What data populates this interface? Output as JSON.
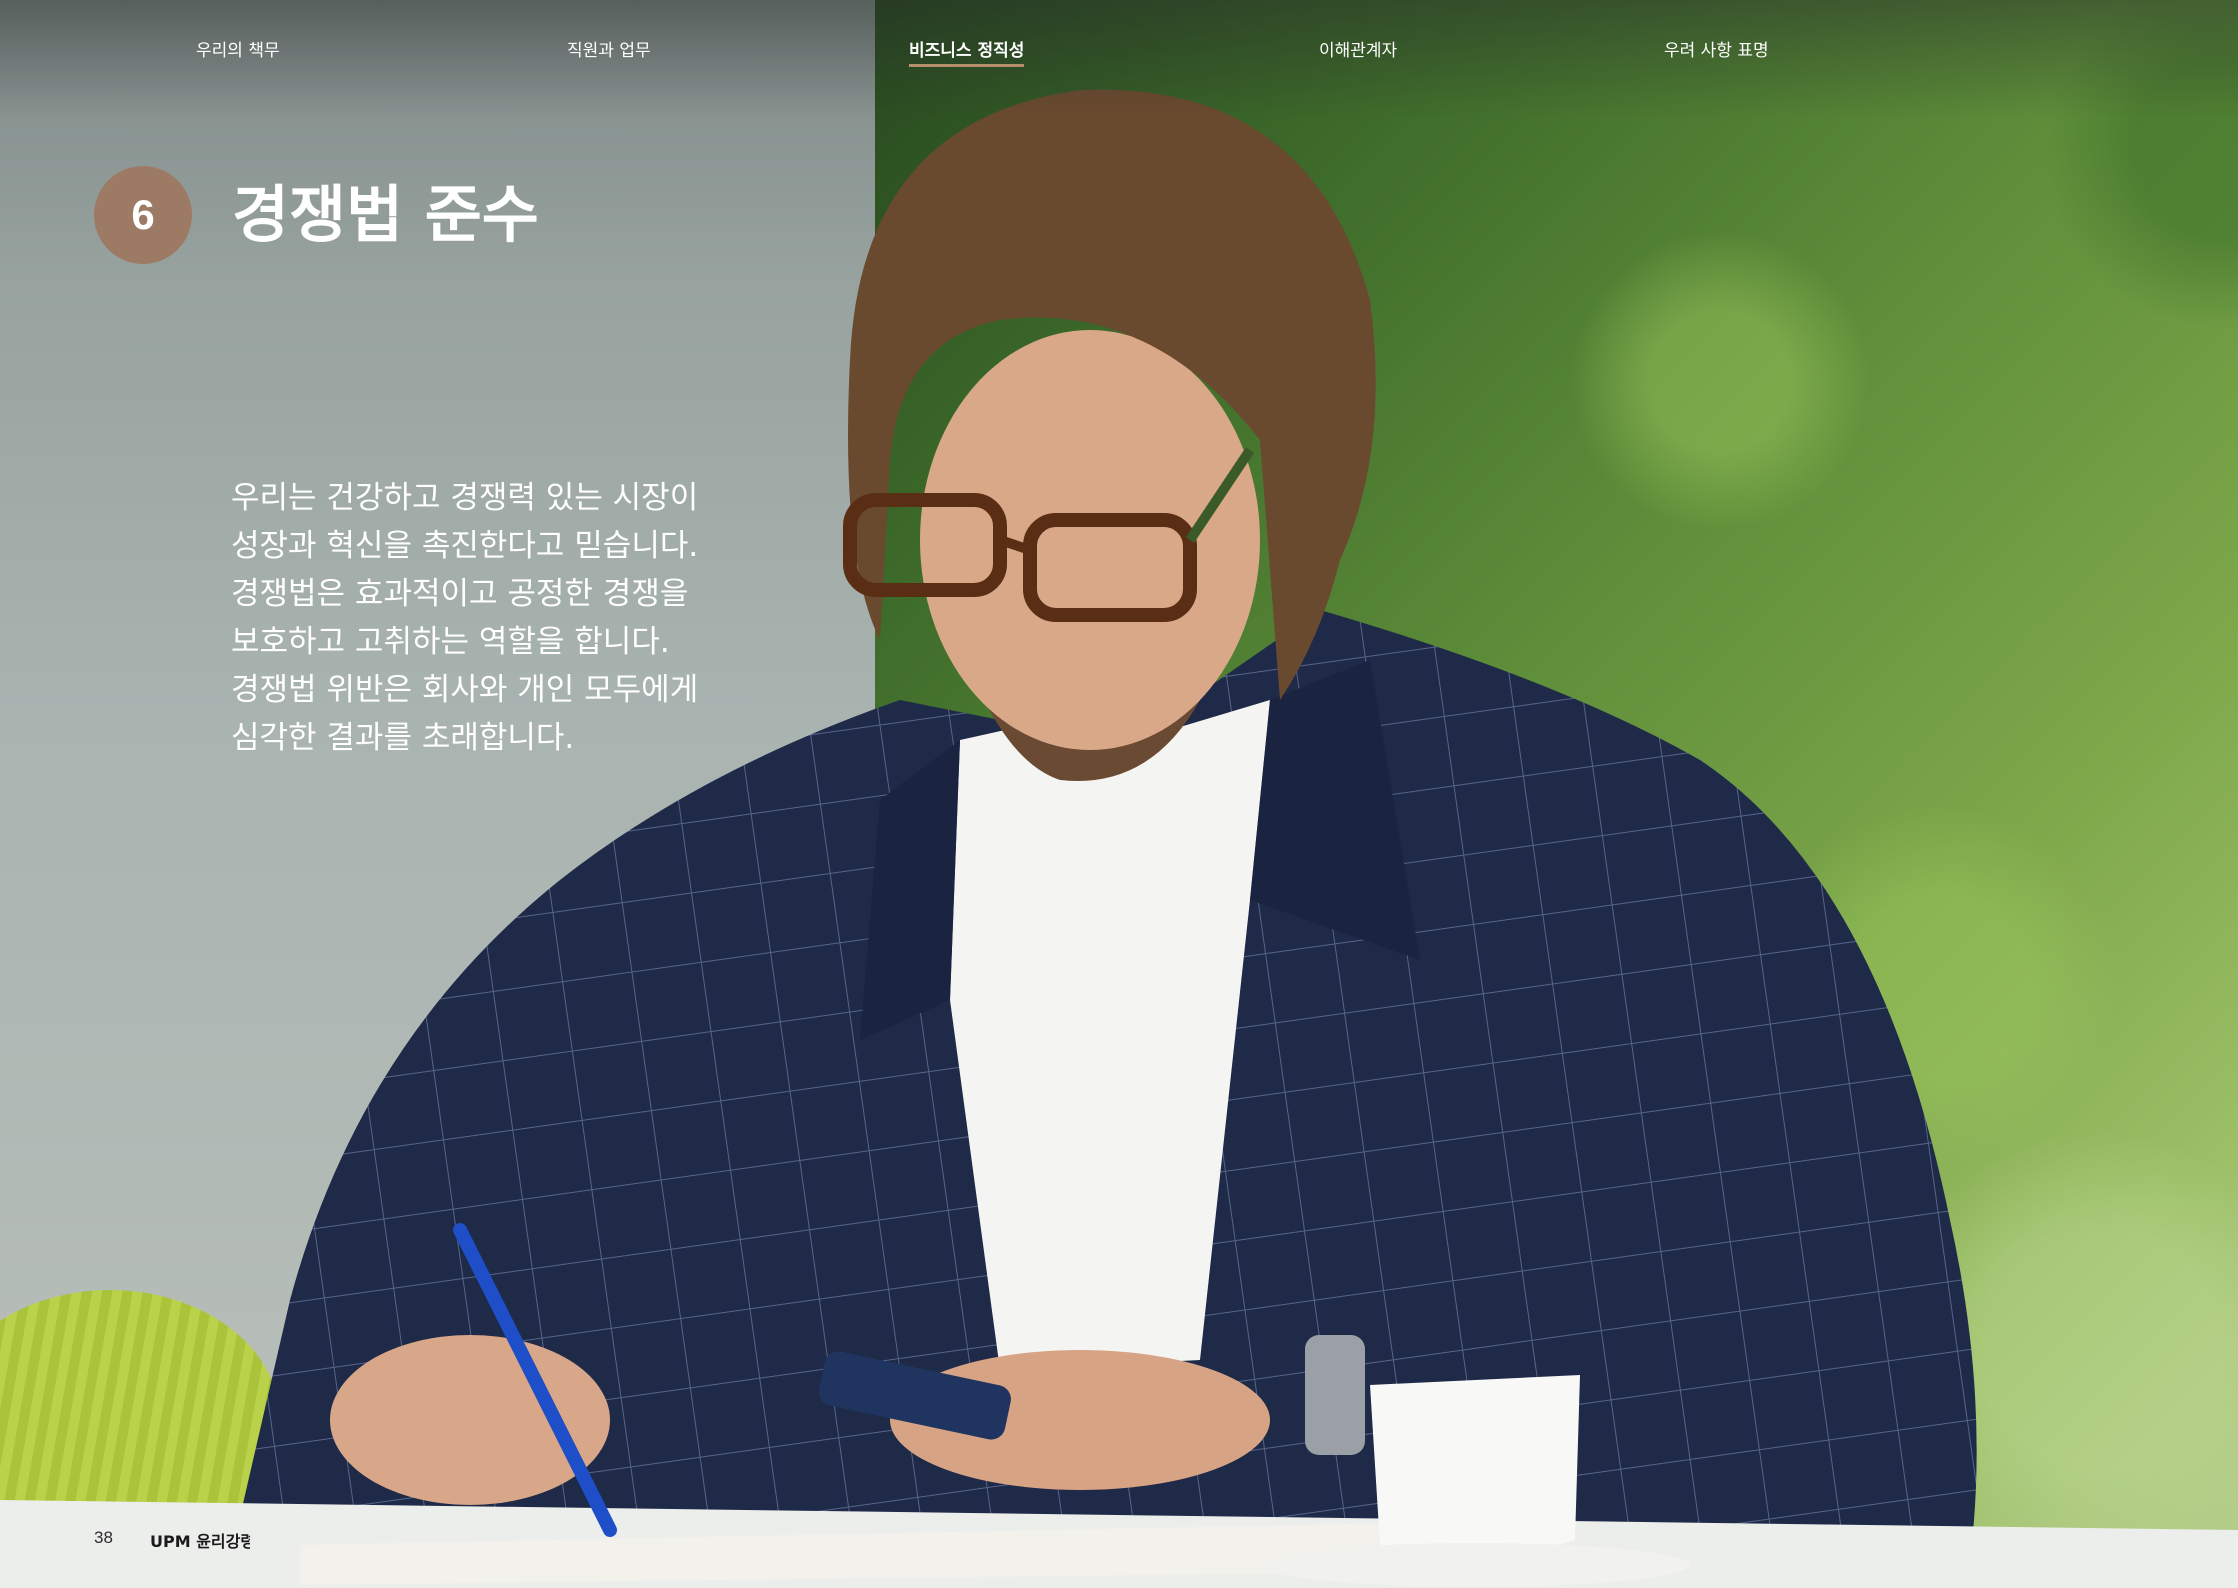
{
  "nav": {
    "items": [
      {
        "label": "우리의 책무",
        "active": false
      },
      {
        "label": "직원과 업무",
        "active": false
      },
      {
        "label": "비즈니스 정직성",
        "active": true
      },
      {
        "label": "이해관계자",
        "active": false
      },
      {
        "label": "우려 사항 표명",
        "active": false
      }
    ]
  },
  "heading": {
    "chapter_number": "6",
    "title": "경쟁법 준수"
  },
  "intro": {
    "lines": [
      "우리는 건강하고 경쟁력 있는 시장이",
      "성장과 혁신을 촉진한다고 믿습니다.",
      "경쟁법은 효과적이고 공정한 경쟁을",
      "보호하고 고취하는 역할을 합니다.",
      "경쟁법 위반은 회사와 개인 모두에게",
      "심각한 결과를 초래합니다."
    ]
  },
  "footer": {
    "page_number": "38",
    "document_title": "UPM 윤리강령"
  },
  "colors": {
    "badge": "#9d7a63",
    "nav_active_underline": "#b58f6c",
    "text": "#ffffff"
  }
}
